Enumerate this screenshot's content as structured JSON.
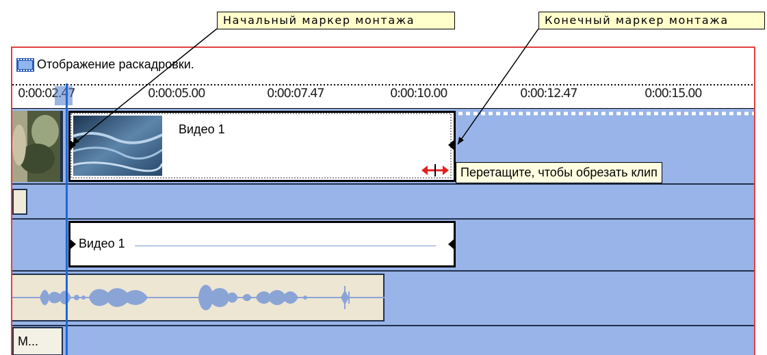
{
  "callouts": {
    "start_marker": "Начальный маркер монтажа",
    "end_marker": "Конечный маркер монтажа"
  },
  "panel": {
    "title": "Отображение раскадровки.",
    "title_icon": "filmstrip-icon"
  },
  "ruler": {
    "ticks": [
      "0:00:02.47",
      "0:00:05.00",
      "0:00:07.47",
      "0:00:10.00",
      "0:00:12.47",
      "0:00:15.00"
    ]
  },
  "video_track": {
    "clip_title": "Видео 1"
  },
  "title_track": {
    "clip_title": "Видео 1"
  },
  "tooltip": {
    "text": "Перетащите, чтобы обрезать клип"
  },
  "music_track": {
    "label": "M..."
  },
  "colors": {
    "track_bg": "#98b4e8",
    "panel_border": "#e04040",
    "playhead": "#1f66d6",
    "trim_cursor": "#e02020"
  }
}
